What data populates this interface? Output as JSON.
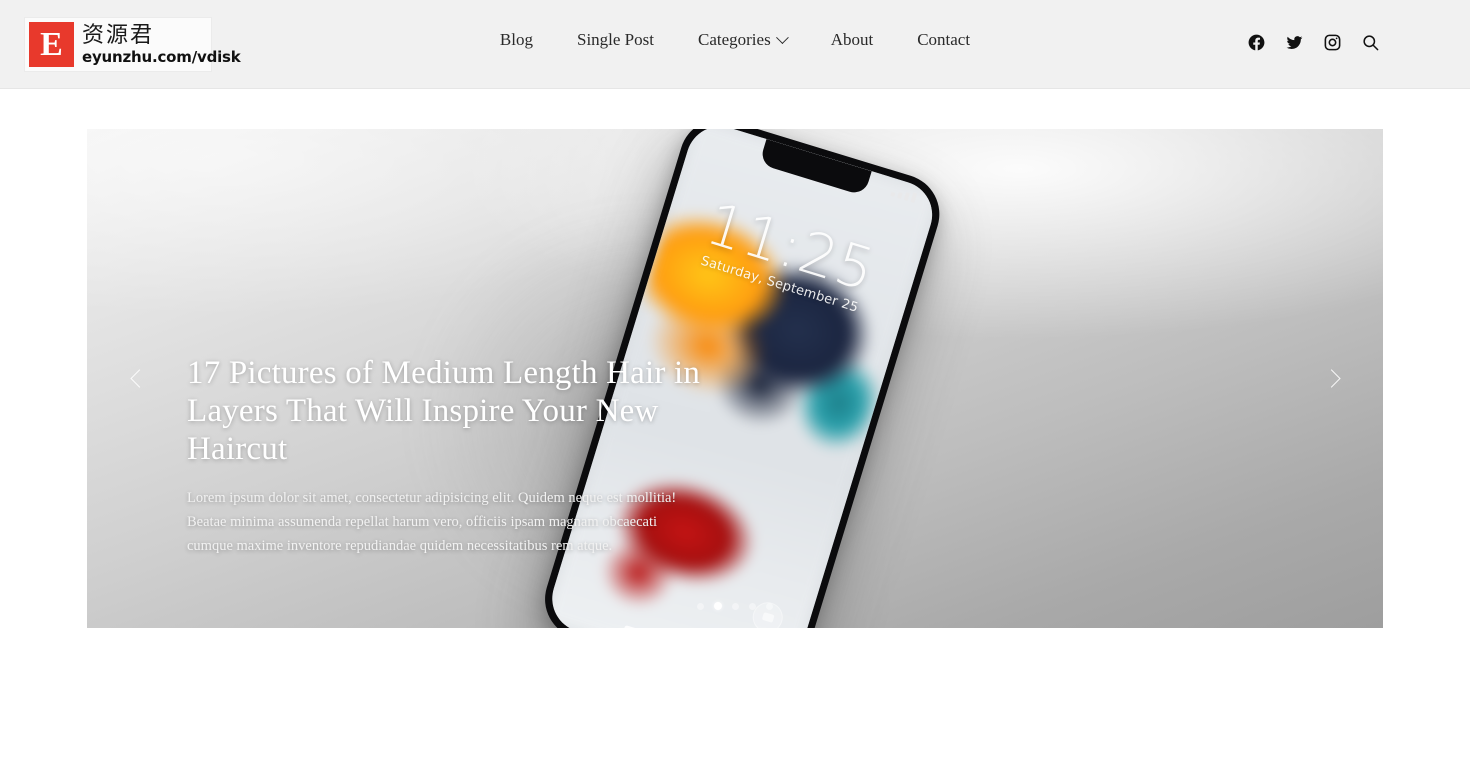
{
  "header": {
    "logo": {
      "mark_letter": "E",
      "mark_color": "#e8392c",
      "cn_name": "资源君",
      "url": "eyunzhu.com/vdisk"
    },
    "nav": [
      {
        "label": "Blog",
        "has_dropdown": false
      },
      {
        "label": "Single Post",
        "has_dropdown": false
      },
      {
        "label": "Categories",
        "has_dropdown": true
      },
      {
        "label": "About",
        "has_dropdown": false
      },
      {
        "label": "Contact",
        "has_dropdown": false
      }
    ],
    "social": [
      {
        "name": "facebook-icon",
        "label": "Facebook"
      },
      {
        "name": "twitter-icon",
        "label": "Twitter"
      },
      {
        "name": "instagram-icon",
        "label": "Instagram"
      },
      {
        "name": "search-icon",
        "label": "Search"
      }
    ],
    "background_color": "#f1f1f1"
  },
  "hero": {
    "title": "17 Pictures of Medium Length Hair in Layers That Will Inspire Your New Haircut",
    "description": "Lorem ipsum dolor sit amet, consectetur adipisicing elit. Quidem neque est mollitia! Beatae minima assumenda repellat harum vero, officiis ipsam magnam obcaecati cumque maxime inventore repudiandae quidem necessitatibus rem atque.",
    "prev_label": "Previous slide",
    "next_label": "Next slide",
    "slide_count": 5,
    "active_slide": 2,
    "image": {
      "subject": "iPhone on light grey background showing lock screen",
      "lock_time": "11:25",
      "lock_date": "Saturday, September 25",
      "status_left": "",
      "wallpaper_colors": [
        "#ffc617",
        "#ff9d10",
        "#1b2540",
        "#2aa0ab",
        "#c41414"
      ]
    }
  },
  "page": {
    "background_color": "#ffffff"
  }
}
